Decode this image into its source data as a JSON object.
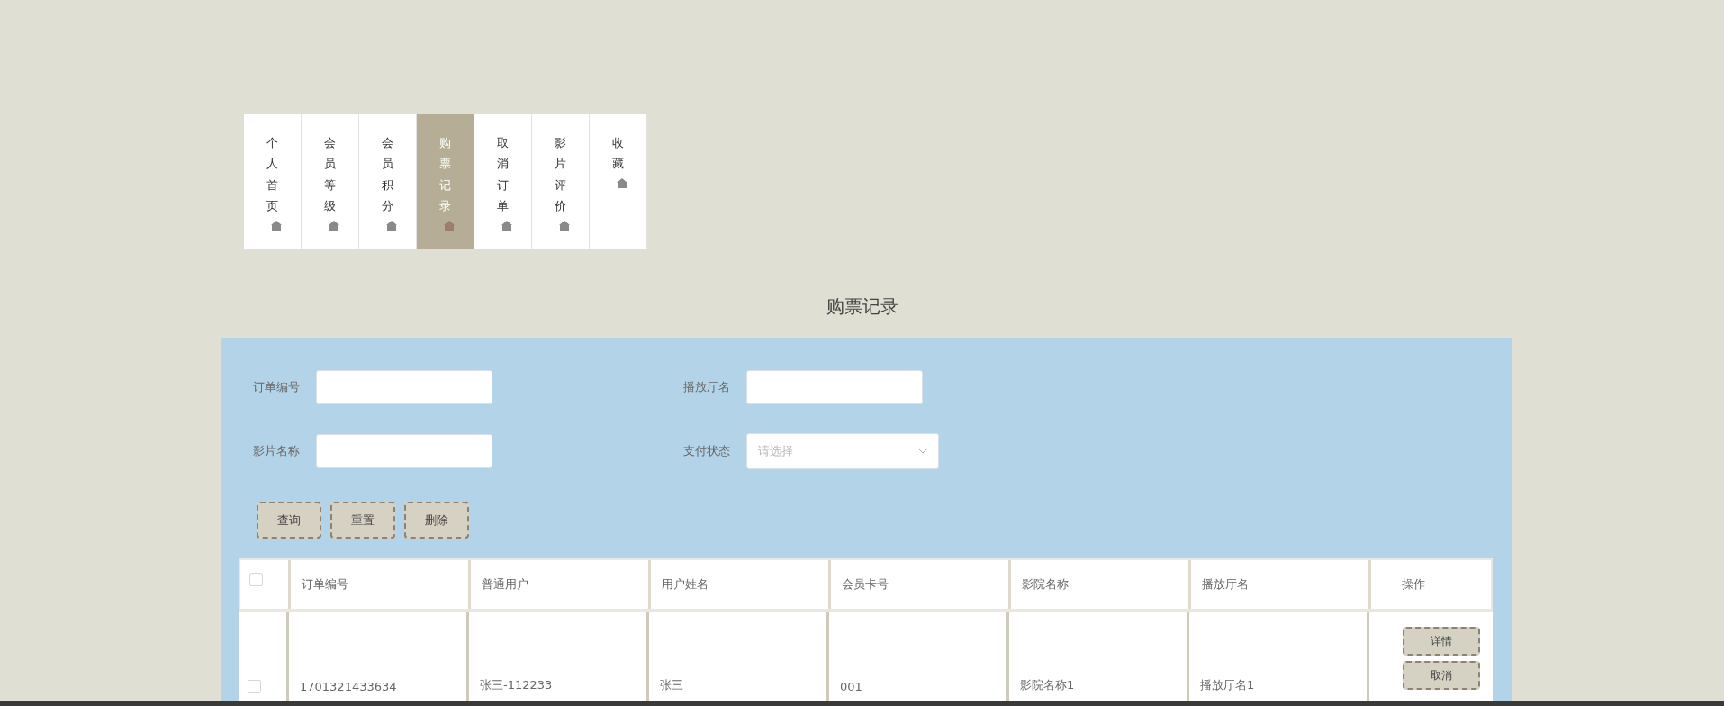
{
  "tabs": [
    {
      "label": "个人首页",
      "selected": false
    },
    {
      "label": "会员等级",
      "selected": false
    },
    {
      "label": "会员积分",
      "selected": false
    },
    {
      "label": "购票记录",
      "selected": true
    },
    {
      "label": "取消订单",
      "selected": false
    },
    {
      "label": "影片评价",
      "selected": false
    },
    {
      "label": "收藏",
      "selected": false
    }
  ],
  "page_title": "购票记录",
  "filters": [
    {
      "kind": "input",
      "label": "订单编号"
    },
    {
      "kind": "input",
      "label": "播放厅名"
    },
    {
      "kind": "input",
      "label": "影片名称"
    },
    {
      "kind": "select",
      "label": "支付状态",
      "placeholder": "请选择"
    }
  ],
  "actions": [
    "查询",
    "重置",
    "删除"
  ],
  "table": {
    "select_all_checked": false,
    "columns": [
      "订单编号",
      "普通用户",
      "用户姓名",
      "会员卡号",
      "影院名称",
      "播放厅名"
    ],
    "action_column": "操作",
    "rows": [
      {
        "checked": false,
        "cells": [
          "1701321433634",
          "张三-112233",
          "张三",
          "001",
          "影院名称1",
          "播放厅名1"
        ],
        "buttons": [
          "详情",
          "取消"
        ]
      }
    ]
  }
}
